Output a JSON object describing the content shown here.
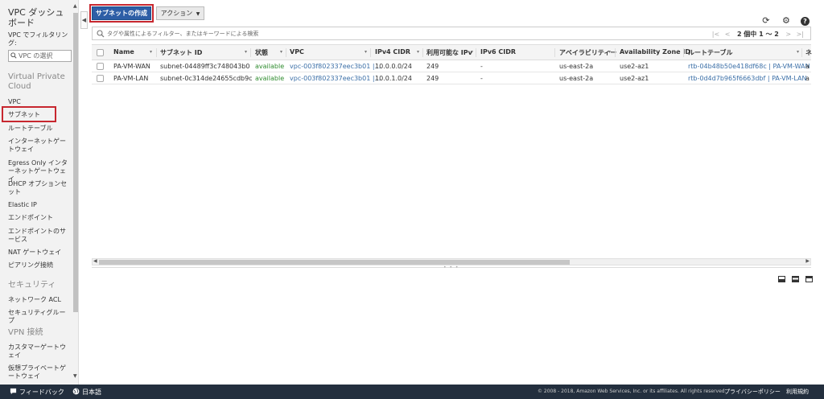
{
  "sidebar": {
    "title": "VPC ダッシュボード",
    "filter_label": "VPC でフィルタリング:",
    "search_placeholder": "VPC の選択",
    "sections": {
      "vpc": "Virtual Private Cloud",
      "security": "セキュリティ",
      "vpn": "VPN 接続"
    },
    "items": {
      "vpc": "VPC",
      "subnet": "サブネット",
      "route_table": "ルートテーブル",
      "igw": "インターネットゲートウェイ",
      "egress": "Egress Only インターネットゲートウェイ",
      "dhcp": "DHCP オプションセット",
      "eip": "Elastic IP",
      "endpoint": "エンドポイント",
      "endpoint_service": "エンドポイントのサービス",
      "nat": "NAT ゲートウェイ",
      "peering": "ピアリング接続",
      "nacl": "ネットワーク ACL",
      "sg": "セキュリティグループ",
      "cgw": "カスタマーゲートウェイ",
      "vgw": "仮想プライベートゲートウェイ"
    }
  },
  "toolbar": {
    "create_label": "サブネットの作成",
    "actions_label": "アクション"
  },
  "filter": {
    "placeholder": "タグや属性によるフィルター、またはキーワードによる検索"
  },
  "pager": {
    "text": "2 個中 1 ～ 2"
  },
  "table": {
    "headers": {
      "name": "Name",
      "subnet_id": "サブネット ID",
      "state": "状態",
      "vpc": "VPC",
      "ipv4": "IPv4 CIDR",
      "available_ip": "利用可能な IPv",
      "ipv6": "IPv6 CIDR",
      "az": "アベイラビリティー",
      "az_id": "Availability Zone ID",
      "route_table": "ルートテーブル",
      "more": "ネ"
    },
    "rows": [
      {
        "name": "PA-VM-WAN",
        "subnet_id": "subnet-04489ff3c748043b0",
        "state": "available",
        "vpc": "vpc-003f802337eec3b01 |...",
        "ipv4": "10.0.0.0/24",
        "available_ip": "249",
        "ipv6": "-",
        "az": "us-east-2a",
        "az_id": "use2-az1",
        "route_table": "rtb-04b48b50e418df68c | PA-VM-WAN",
        "more": "a"
      },
      {
        "name": "PA-VM-LAN",
        "subnet_id": "subnet-0c314de24655cdb9c",
        "state": "available",
        "vpc": "vpc-003f802337eec3b01 |...",
        "ipv4": "10.0.1.0/24",
        "available_ip": "249",
        "ipv6": "-",
        "az": "us-east-2a",
        "az_id": "use2-az1",
        "route_table": "rtb-0d4d7b965f6663dbf | PA-VM-LAN",
        "more": "a"
      }
    ]
  },
  "footer": {
    "feedback": "フィードバック",
    "language": "日本語",
    "copyright": "© 2008 - 2018, Amazon Web Services, Inc. or its affiliates. All rights reserved.",
    "privacy": "プライバシーポリシー",
    "terms": "利用規約"
  },
  "colors": {
    "primary_button": "#2d5ea6",
    "highlight_border": "#c7272f",
    "status_available": "#2e8b2e",
    "link": "#3b6fa7",
    "footer_bg": "#232f3e"
  }
}
